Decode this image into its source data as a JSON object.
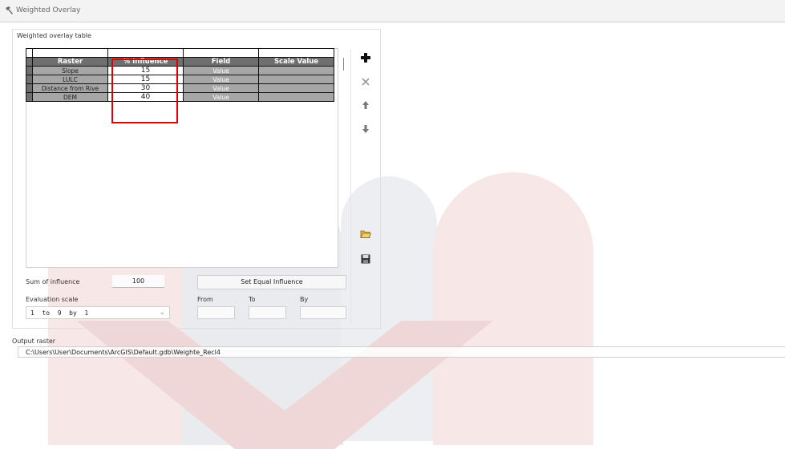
{
  "window": {
    "title": "Weighted Overlay"
  },
  "group_label": "Weighted overlay table",
  "table": {
    "columns": [
      "Raster",
      "% Influence",
      "Field",
      "Scale Value"
    ],
    "rows": [
      {
        "raster": "Slope",
        "influence": "15",
        "field": "Value",
        "scale_value": ""
      },
      {
        "raster": "LULC",
        "influence": "15",
        "field": "Value",
        "scale_value": ""
      },
      {
        "raster": "Distance from Rive",
        "influence": "30",
        "field": "Value",
        "scale_value": ""
      },
      {
        "raster": "DEM",
        "influence": "40",
        "field": "Value",
        "scale_value": ""
      }
    ]
  },
  "toolbar_icons": [
    "add-icon",
    "remove-icon",
    "move-up-icon",
    "move-down-icon",
    "open-folder-icon",
    "save-icon"
  ],
  "sum": {
    "label": "Sum of influence",
    "value": "100"
  },
  "equal_influence_label": "Set Equal Influence",
  "evaluation": {
    "label": "Evaluation scale",
    "value": "1  to  9  by  1",
    "from_label": "From",
    "to_label": "To",
    "by_label": "By",
    "from_value": "",
    "to_value": "",
    "by_value": ""
  },
  "output": {
    "label": "Output raster",
    "path": "C:\\Users\\User\\Documents\\ArcGIS\\Default.gdb\\Weighte_Recl4"
  },
  "colors": {
    "highlight": "#e00000",
    "header_bg": "#6f6f6f",
    "row_bg": "#a6a6a6"
  }
}
